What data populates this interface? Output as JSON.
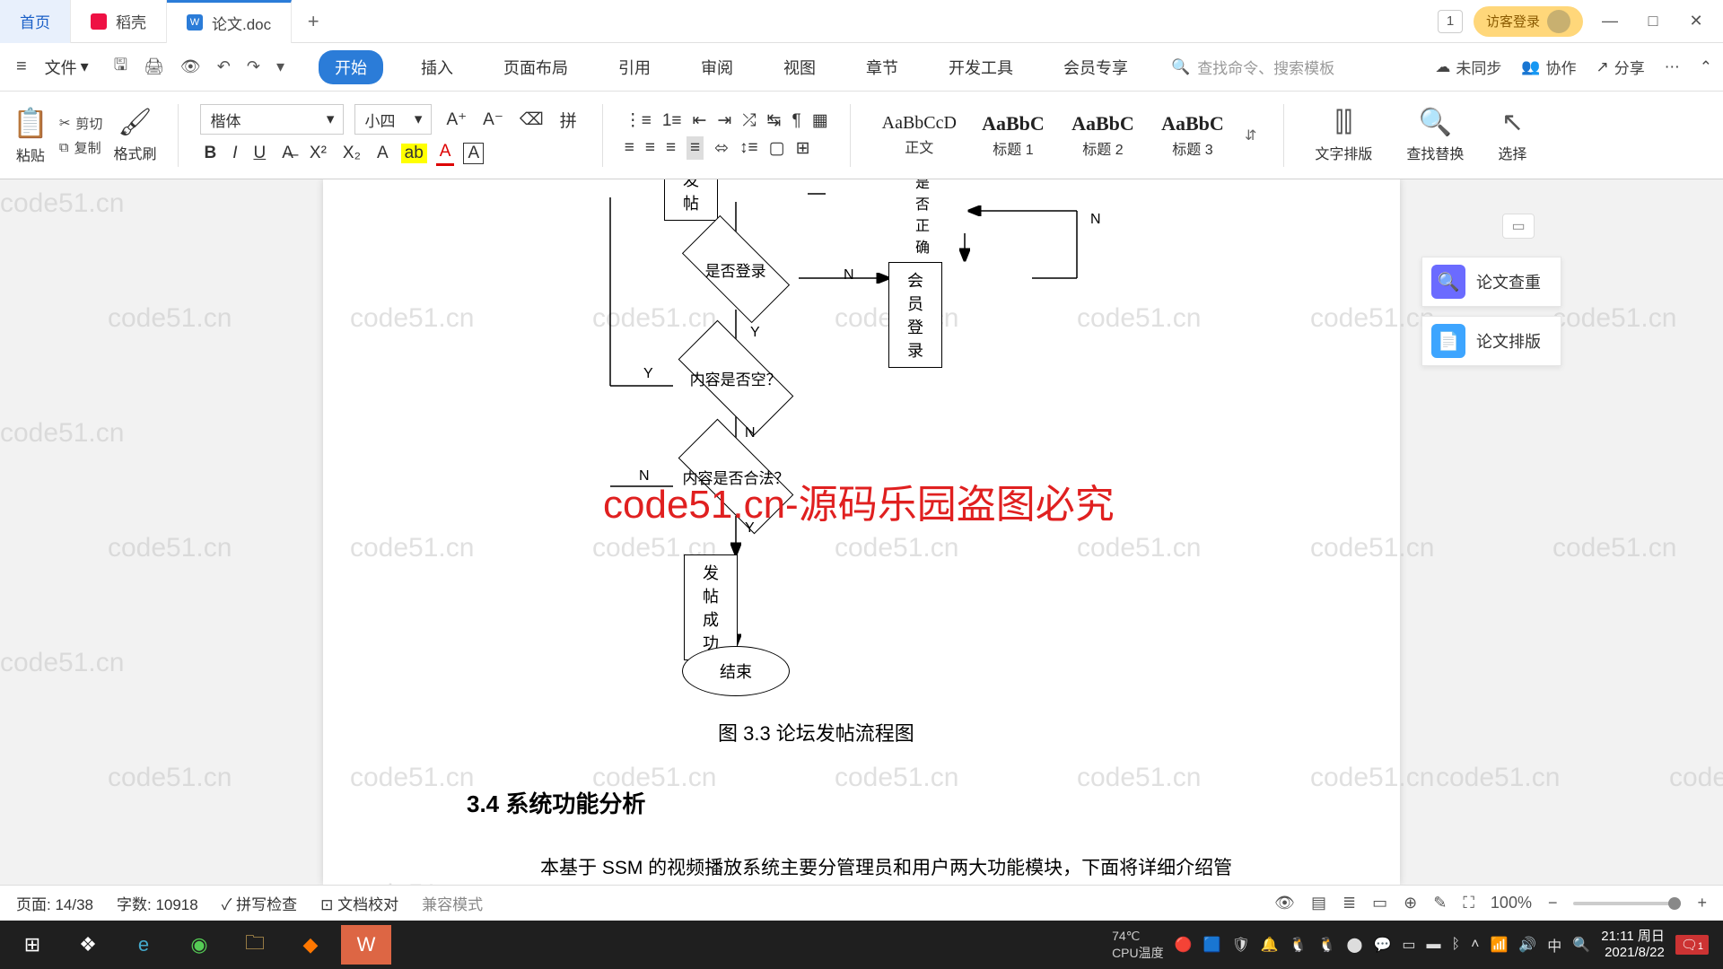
{
  "titlebar": {
    "tabs": [
      {
        "label": "首页",
        "kind": "home"
      },
      {
        "label": "稻壳",
        "kind": "docer"
      },
      {
        "label": "论文.doc",
        "kind": "doc",
        "active": true
      }
    ],
    "tab_count_badge": "1",
    "guest_login": "访客登录",
    "window_controls": {
      "min": "—",
      "max": "□",
      "close": "✕"
    }
  },
  "menubar": {
    "file": "文件",
    "qat": {
      "save": "save-icon",
      "undo": "undo-icon",
      "redo": "redo-icon",
      "print": "print-icon",
      "preview": "preview-icon",
      "more": "▾"
    },
    "tabs": [
      "开始",
      "插入",
      "页面布局",
      "引用",
      "审阅",
      "视图",
      "章节",
      "开发工具",
      "会员专享"
    ],
    "active_tab": "开始",
    "search_placeholder": "查找命令、搜索模板",
    "unsynced": "未同步",
    "collab": "协作",
    "share": "分享"
  },
  "ribbon": {
    "paste": "粘贴",
    "cut": "剪切",
    "copy": "复制",
    "format_painter": "格式刷",
    "font_name": "楷体",
    "font_size": "小四",
    "styles": [
      {
        "preview": "AaBbCcD",
        "name": "正文"
      },
      {
        "preview": "AaBbC",
        "name": "标题 1",
        "big": true
      },
      {
        "preview": "AaBbC",
        "name": "标题 2",
        "big": true
      },
      {
        "preview": "AaBbC",
        "name": "标题 3",
        "big": true
      }
    ],
    "text_layout": "文字排版",
    "find_replace": "查找替换",
    "select": "选择"
  },
  "document": {
    "flow": {
      "top_box": "发帖",
      "top_right": "是否正确",
      "d1": "是否登录",
      "login_box": "会员登录",
      "d2": "内容是否空？",
      "d3": "内容是否合法？",
      "success_box": "发帖成功",
      "end_oval": "结束",
      "Y": "Y",
      "N": "N"
    },
    "caption": "图 3.3    论坛发帖流程图",
    "heading": "3.4 系统功能分析",
    "paragraph": "本基于 SSM 的视频播放系统主要分管理员和用户两大功能模块，下面将详细介绍管理员和用户分别实现的功能。",
    "watermark_text": "code51.cn",
    "red_overlay": "code51.cn-源码乐园盗图必究"
  },
  "side_panel": {
    "collapse": "▭",
    "items": [
      {
        "label": "论文查重",
        "color": "#6b6bff"
      },
      {
        "label": "论文排版",
        "color": "#3da5ff"
      }
    ]
  },
  "statusbar": {
    "page": "页面: 14/38",
    "words": "字数: 10918",
    "spellcheck": "拼写检查",
    "doc_proof": "文档校对",
    "compat": "兼容模式",
    "zoom": "100%"
  },
  "taskbar": {
    "cpu_temp": "CPU温度",
    "temp_value": "74℃",
    "ime": "中",
    "time": "21:11 周日",
    "date": "2021/8/22",
    "notif_count": "1"
  }
}
